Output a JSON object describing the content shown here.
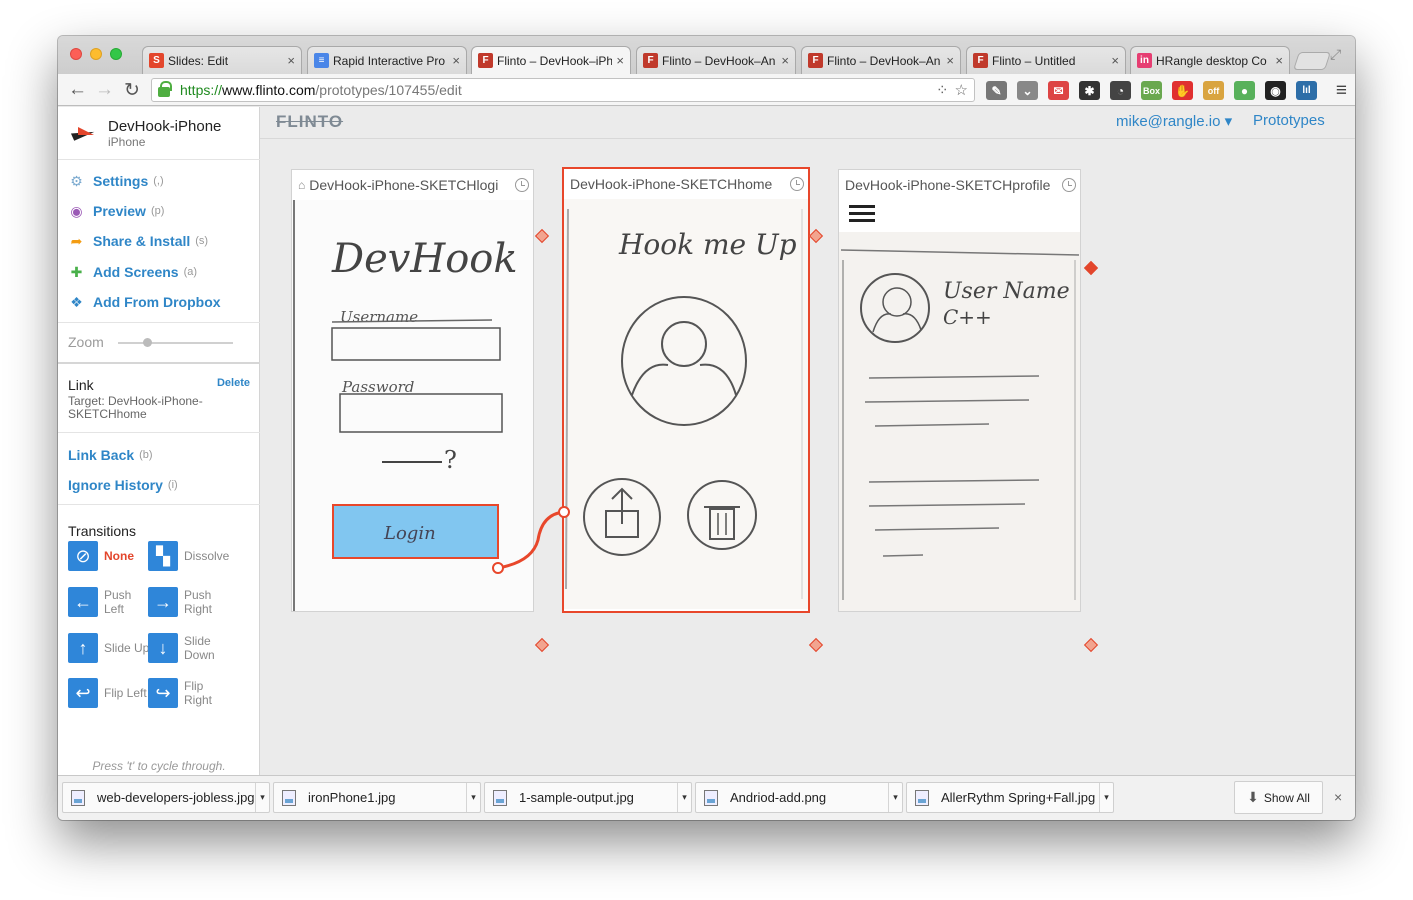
{
  "browser": {
    "tabs": [
      {
        "title": "Slides: Edit",
        "icon": "S",
        "color": "#e3462c"
      },
      {
        "title": "Rapid Interactive Pro",
        "icon": "≡",
        "color": "#4a86e8"
      },
      {
        "title": "Flinto – DevHook–iPh",
        "icon": "F",
        "color": "#c0392b"
      },
      {
        "title": "Flinto – DevHook–An",
        "icon": "F",
        "color": "#c0392b"
      },
      {
        "title": "Flinto – DevHook–An",
        "icon": "F",
        "color": "#c0392b"
      },
      {
        "title": "Flinto – Untitled",
        "icon": "F",
        "color": "#c0392b"
      },
      {
        "title": "HRangle desktop Co",
        "icon": "in",
        "color": "#e63e72"
      }
    ],
    "tab_close": "×",
    "url_scheme": "https://",
    "url_host": "www.flinto.com",
    "url_path": "/prototypes/107455/edit",
    "extensions": [
      {
        "label": "✎",
        "color": "#555"
      },
      {
        "label": "⌄",
        "color": "#666"
      },
      {
        "label": "✉",
        "color": "#d44"
      },
      {
        "label": "✱",
        "color": "#333"
      },
      {
        "label": "◔",
        "color": "#444"
      },
      {
        "label": "Box",
        "color": "#6aa84f"
      },
      {
        "label": "✋",
        "color": "#e03030"
      },
      {
        "label": "off",
        "color": "#d9a440"
      },
      {
        "label": "●",
        "color": "#58b15b"
      },
      {
        "label": "◉",
        "color": "#222"
      },
      {
        "label": "lıl",
        "color": "#2d6ea8"
      }
    ]
  },
  "sidebar": {
    "project_title": "DevHook-iPhone",
    "project_subtitle": "iPhone",
    "menu": [
      {
        "label": "Settings",
        "key": "(,)",
        "icon": "⚙",
        "icon_color": "#7aa9cf"
      },
      {
        "label": "Preview",
        "key": "(p)",
        "icon": "◉",
        "icon_color": "#9b59b6"
      },
      {
        "label": "Share & Install",
        "key": "(s)",
        "icon": "➦",
        "icon_color": "#f39c12"
      },
      {
        "label": "Add Screens",
        "key": "(a)",
        "icon": "✚",
        "icon_color": "#49b04a"
      },
      {
        "label": "Add From Dropbox",
        "key": "",
        "icon": "❖",
        "icon_color": "#2f86c7"
      }
    ],
    "zoom_label": "Zoom",
    "link": {
      "title": "Link",
      "delete_label": "Delete",
      "target": "Target: DevHook-iPhone-SKETCHhome"
    },
    "link_actions": [
      {
        "label": "Link Back",
        "key": "(b)"
      },
      {
        "label": "Ignore History",
        "key": "(i)"
      }
    ],
    "transitions_title": "Transitions",
    "transitions": [
      {
        "label": "None",
        "icon": "⊘",
        "selected": true
      },
      {
        "label": "Dissolve",
        "icon": "▚",
        "selected": false
      },
      {
        "label": "Push Left",
        "icon": "←",
        "selected": false
      },
      {
        "label": "Push Right",
        "icon": "→",
        "selected": false
      },
      {
        "label": "Slide Up",
        "icon": "↑",
        "selected": false
      },
      {
        "label": "Slide Down",
        "icon": "↓",
        "selected": false
      },
      {
        "label": "Flip Left",
        "icon": "↩",
        "selected": false
      },
      {
        "label": "Flip Right",
        "icon": "↪",
        "selected": false
      }
    ],
    "hint": "Press 't' to cycle through."
  },
  "header": {
    "logo": "FLINTO",
    "user": "mike@rangle.io ▾",
    "prototypes_link": "Prototypes"
  },
  "screens": [
    {
      "name": "DevHook-iPhone-SKETCHlogi",
      "home": "⌂"
    },
    {
      "name": "DevHook-iPhone-SKETCHhome",
      "home": ""
    },
    {
      "name": "DevHook-iPhone-SKETCHprofile",
      "home": ""
    }
  ],
  "sketches": {
    "login": {
      "title": "DevHook",
      "username": "Username",
      "password": "Password",
      "question": "?",
      "button": "Login"
    },
    "home": {
      "title": "Hook me Up"
    },
    "profile": {
      "name": "User Name",
      "sub": "C++"
    }
  },
  "downloads": [
    {
      "name": "web-developers-jobless.jpg"
    },
    {
      "name": "ironPhone1.jpg"
    },
    {
      "name": "1-sample-output.jpg"
    },
    {
      "name": "Andriod-add.png"
    },
    {
      "name": "AllerRythm Spring+Fall.jpg"
    }
  ],
  "show_all_label": "Show All",
  "download_bar_close": "×"
}
